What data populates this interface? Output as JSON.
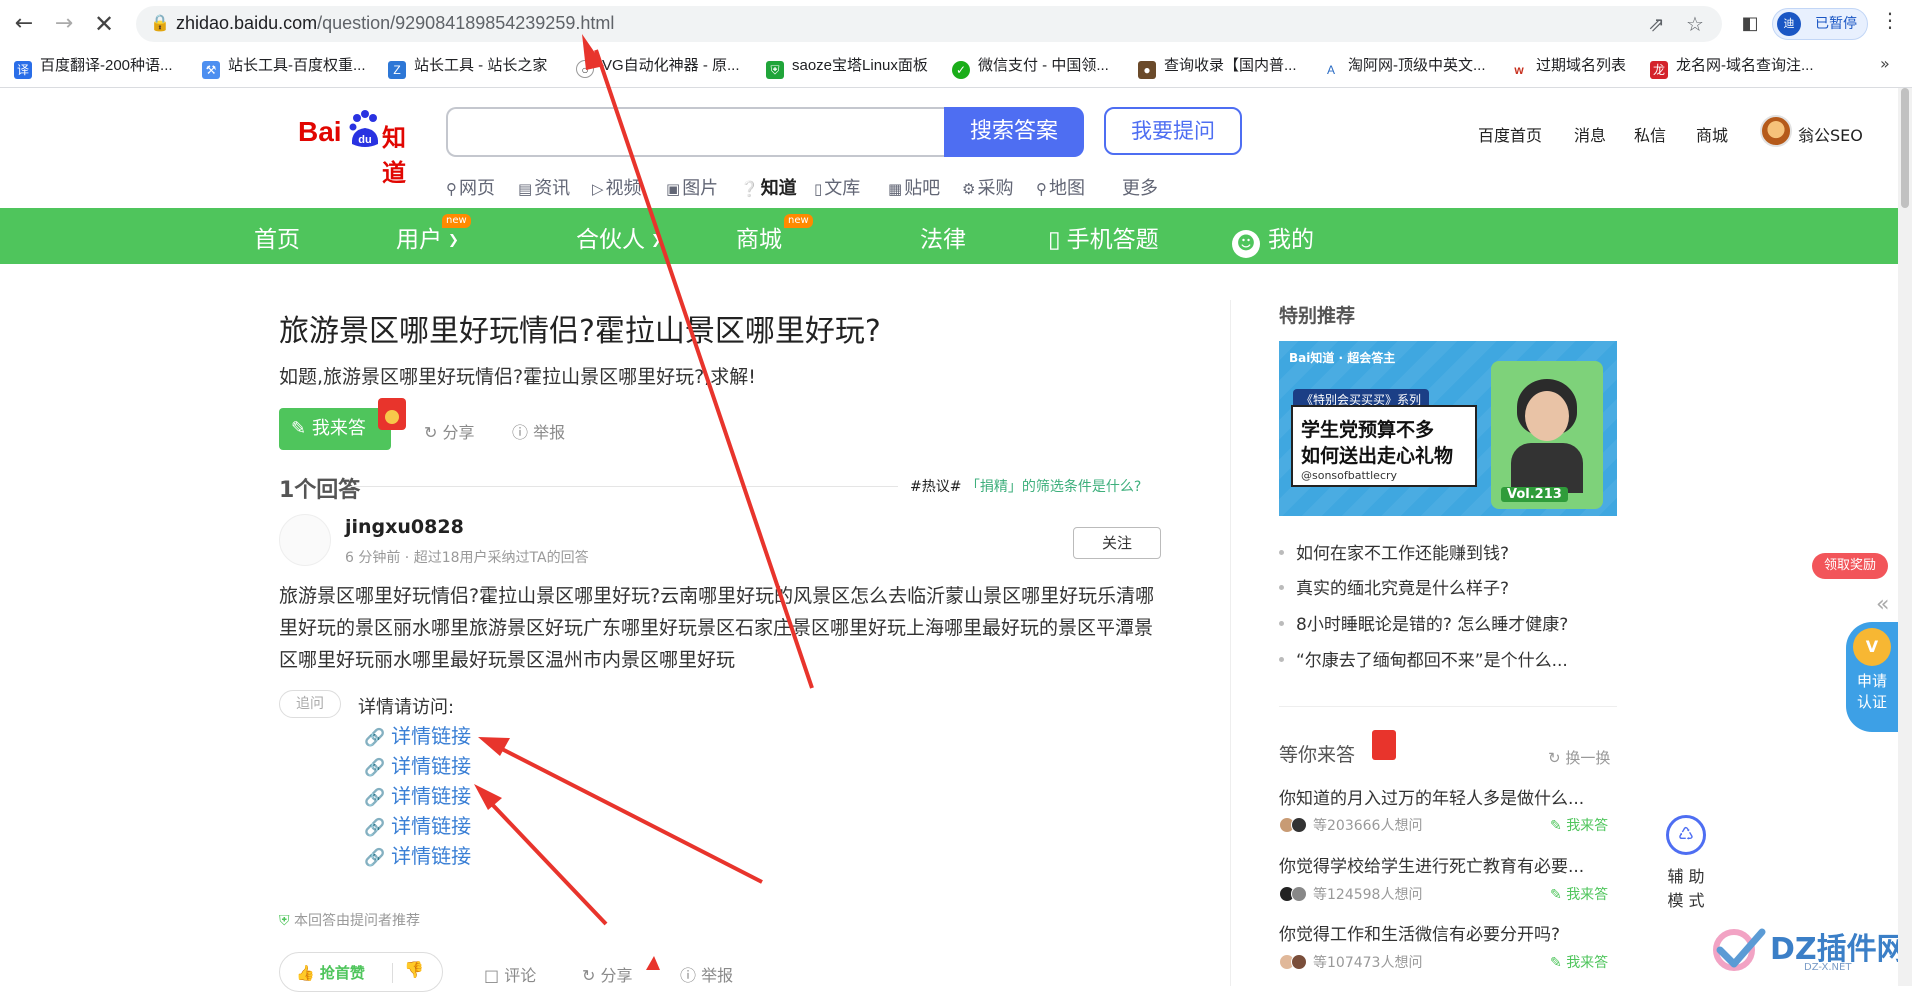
{
  "browser": {
    "url_host": "zhidao.baidu.com",
    "url_path": "/question/929084189854239259.html",
    "profile_label": "已暂停",
    "profile_initial": "迪",
    "bookmarks": [
      {
        "label": "百度翻译-200种语...",
        "icon": "translate-icon",
        "color": "#2a6ee8"
      },
      {
        "label": "站长工具-百度权重...",
        "icon": "tool-icon",
        "color": "#4d8ff0"
      },
      {
        "label": "站长工具 - 站长之家",
        "icon": "chinaz-icon",
        "color": "#2d77d6"
      },
      {
        "label": "VG自动化神器 - 原...",
        "icon": "vg-icon",
        "color": "#333333"
      },
      {
        "label": "saoze宝塔Linux面板",
        "icon": "shield-icon",
        "color": "#20a53a"
      },
      {
        "label": "微信支付 - 中国领...",
        "icon": "wechat-pay-icon",
        "color": "#1aad19"
      },
      {
        "label": "查询收录【国内普...",
        "icon": "dog-icon",
        "color": "#6b4a2a"
      },
      {
        "label": "淘阿网-顶级中英文...",
        "icon": "taoa-icon",
        "color": "#2b6cc4"
      },
      {
        "label": "过期域名列表",
        "icon": "w-icon",
        "color": "#c7301e"
      },
      {
        "label": "龙名网-域名查询注...",
        "icon": "dragon-icon",
        "color": "#d4232b"
      }
    ]
  },
  "header": {
    "logo_text": "Bai",
    "logo_zhidao": "知道",
    "search_button": "搜索答案",
    "ask_button": "我要提问",
    "top_links": [
      "百度首页",
      "消息",
      "私信",
      "商城"
    ],
    "user_name": "翁公SEO",
    "product_tabs": [
      {
        "label": "网页",
        "icon": "search-icon"
      },
      {
        "label": "资讯",
        "icon": "news-icon"
      },
      {
        "label": "视频",
        "icon": "video-icon"
      },
      {
        "label": "图片",
        "icon": "image-icon"
      },
      {
        "label": "知道",
        "icon": "question-icon",
        "active": true
      },
      {
        "label": "文库",
        "icon": "doc-icon"
      },
      {
        "label": "贴吧",
        "icon": "tieba-icon"
      },
      {
        "label": "采购",
        "icon": "purchase-icon"
      },
      {
        "label": "地图",
        "icon": "map-icon"
      },
      {
        "label": "更多",
        "icon": ""
      }
    ]
  },
  "nav": {
    "items": [
      "首页",
      "用户",
      "合伙人",
      "商城",
      "法律",
      "手机答题",
      "我的"
    ],
    "new_tag": "new"
  },
  "question": {
    "title": "旅游景区哪里好玩情侣?霍拉山景区哪里好玩?",
    "desc": "如题,旅游景区哪里好玩情侣?霍拉山景区哪里好玩?,求解!",
    "answer_button": "我来答",
    "share": "分享",
    "report": "举报"
  },
  "answers": {
    "count_label": "1个回答",
    "hot_prefix": "#热议#",
    "hot_question": "「捐精」的筛选条件是什么?",
    "user": "jingxu0828",
    "meta": "6 分钟前 · 超过18用户采纳过TA的回答",
    "follow": "关注",
    "body": "旅游景区哪里好玩情侣?霍拉山景区哪里好玩?云南哪里好玩的风景区怎么去临沂蒙山景区哪里好玩乐清哪里好玩的景区丽水哪里旅游景区好玩广东哪里好玩景区石家庄景区哪里好玩上海哪里最好玩的景区平潭景区哪里好玩丽水哪里最好玩景区温州市内景区哪里好玩",
    "zhuiwen": "追问",
    "detail_label": "详情请访问:",
    "links": [
      "详情链接",
      "详情链接",
      "详情链接",
      "详情链接",
      "详情链接"
    ],
    "recommended": "本回答由提问者推荐",
    "like": "抢首赞",
    "comment": "评论",
    "share": "分享",
    "report": "举报"
  },
  "sidebar": {
    "title": "特别推荐",
    "banner": {
      "brand": "Bai知道 · 超会答主",
      "series": "《特别会买买买》系列",
      "line1": "学生党预算不多",
      "line2": "如何送出走心礼物",
      "handle": "@sonsofbattlecry",
      "vol": "Vol.213"
    },
    "recommend_items": [
      "如何在家不工作还能赚到钱?",
      "真实的缅北究竟是什么样子?",
      "8小时睡眠论是错的? 怎么睡才健康?",
      "“尔康去了缅甸都回不来”是个什么..."
    ],
    "wait_title": "等你来答",
    "swap": "换一换",
    "wait_items": [
      {
        "q": "你知道的月入过万的年轻人多是做什么...",
        "meta": "等203666人想问",
        "a": "我来答"
      },
      {
        "q": "你觉得学校给学生进行死亡教育有必要...",
        "meta": "等124598人想问",
        "a": "我来答"
      },
      {
        "q": "你觉得工作和生活微信有必要分开吗?",
        "meta": "等107473人想问",
        "a": "我来答"
      }
    ]
  },
  "floating": {
    "lingqu": "领取奖励",
    "apply_line1": "申请",
    "apply_line2": "认证",
    "apply_badge": "V",
    "fuzhu_line1": "辅 助",
    "fuzhu_line2": "模 式",
    "dz_text": "DZ插件网",
    "dz_sub": "DZ-X.NET"
  },
  "colors": {
    "baidu_red": "#e10601",
    "baidu_blue": "#4e6ef2",
    "zhidao_green": "#4fc55c",
    "annotation_red": "#e8342c"
  }
}
